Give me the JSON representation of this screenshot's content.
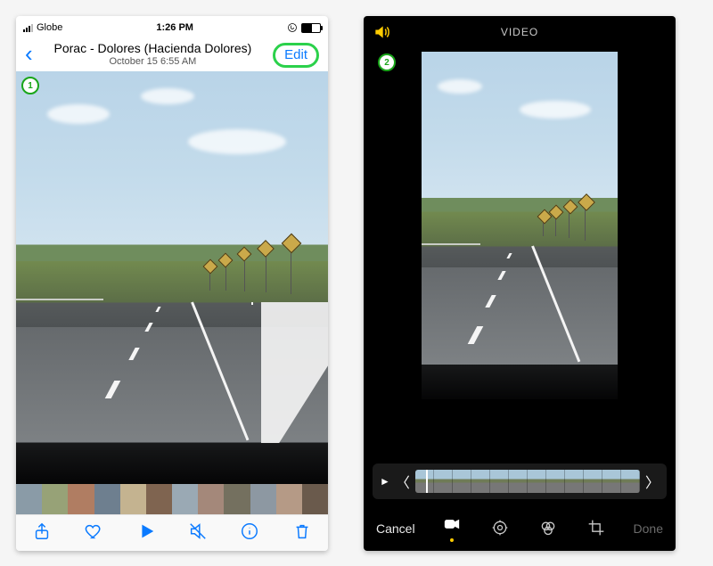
{
  "left": {
    "status": {
      "carrier": "Globe",
      "time": "1:26 PM"
    },
    "nav": {
      "title": "Porac - Dolores (Hacienda Dolores)",
      "subtitle": "October 15  6:55 AM",
      "edit_label": "Edit"
    },
    "step": "1",
    "toolbar": {
      "share": "share-icon",
      "favorite": "heart-icon",
      "play": "play-icon",
      "mute": "speaker-off-icon",
      "info": "info-icon",
      "trash": "trash-icon"
    }
  },
  "right": {
    "header": "VIDEO",
    "step": "2",
    "scrubber": {
      "play": "►"
    },
    "edit_toolbar": {
      "cancel": "Cancel",
      "done": "Done",
      "modes": {
        "video": "video-mode-icon",
        "adjust": "adjust-icon",
        "filters": "filters-icon",
        "crop": "crop-icon"
      }
    }
  }
}
